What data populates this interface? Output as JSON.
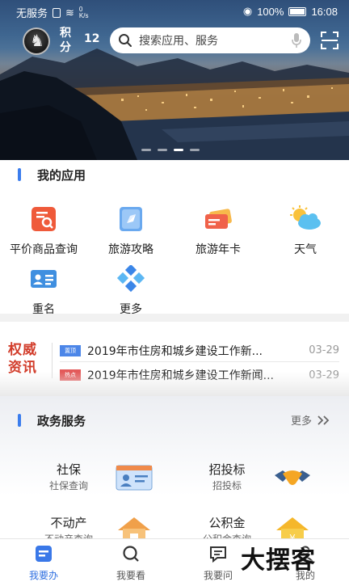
{
  "status_bar": {
    "carrier": "无服务",
    "speed": "0",
    "speed_unit": "K/s",
    "battery_pct": "100%",
    "time": "16:08"
  },
  "header": {
    "points_label": "积分",
    "points_value": "12",
    "search_placeholder": "搜索应用、服务"
  },
  "my_apps": {
    "title": "我的应用",
    "items": [
      {
        "label": "平价商品查询",
        "icon": "price-search-icon"
      },
      {
        "label": "旅游攻略",
        "icon": "travel-guide-icon"
      },
      {
        "label": "旅游年卡",
        "icon": "travel-card-icon"
      },
      {
        "label": "天气",
        "icon": "weather-icon"
      },
      {
        "label": "重名",
        "icon": "name-card-icon"
      },
      {
        "label": "更多",
        "icon": "more-apps-icon"
      }
    ]
  },
  "news": {
    "badge": "权威资讯",
    "items": [
      {
        "tag": "置顶",
        "title": "2019年市住房和城乡建设工作新...",
        "date": "03-29"
      },
      {
        "tag": "热点",
        "title": "2019年市住房和城乡建设工作新闻...",
        "date": "03-29"
      }
    ]
  },
  "gov_services": {
    "title": "政务服务",
    "more_label": "更多",
    "items": [
      {
        "name": "社保",
        "sub": "社保查询",
        "icon": "social-security-card-icon"
      },
      {
        "name": "招投标",
        "sub": "招投标",
        "icon": "handshake-icon"
      },
      {
        "name": "不动产",
        "sub": "不动产查询",
        "icon": "house-icon"
      },
      {
        "name": "公积金",
        "sub": "公积金查询",
        "icon": "housing-fund-icon"
      }
    ]
  },
  "bottom_nav": {
    "tabs": [
      {
        "label": "我要办",
        "active": true
      },
      {
        "label": "我要看",
        "active": false
      },
      {
        "label": "我要问",
        "active": false
      },
      {
        "label": "我的",
        "active": false
      }
    ]
  },
  "watermark": "大摆客",
  "colors": {
    "accent": "#3b7ded",
    "news_badge": "#d23d2b",
    "active_tab": "#2f6fe0"
  }
}
